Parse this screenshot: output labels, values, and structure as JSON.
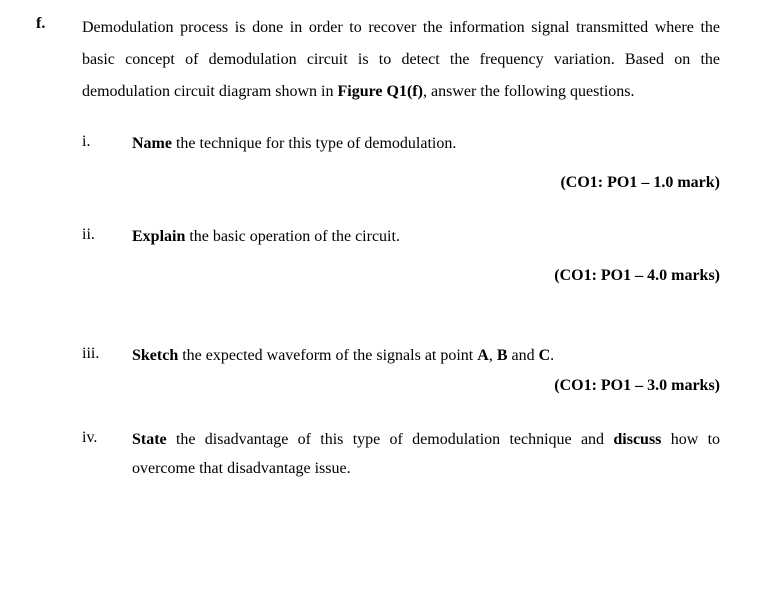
{
  "question": {
    "label": "f.",
    "intro_part1": "Demodulation process is done in order to recover the information signal transmitted where the basic concept of demodulation circuit is to detect the frequency variation. Based on the demodulation circuit diagram shown in ",
    "intro_bold": "Figure Q1(f)",
    "intro_part2": ", answer the following questions."
  },
  "subs": [
    {
      "label": "i.",
      "verb": "Name",
      "text": " the technique for this type of demodulation.",
      "marks": "(CO1: PO1 – 1.0 mark)",
      "marks_class": "marks"
    },
    {
      "label": "ii.",
      "verb": "Explain",
      "text": " the basic operation of the circuit.",
      "marks": "(CO1: PO1 – 4.0 marks)",
      "marks_class": "marks",
      "extra_gap": true
    },
    {
      "label": "iii.",
      "verb": "Sketch",
      "text_before": " the expected waveform of the signals at point ",
      "bold_mid1": "A",
      "mid1": ", ",
      "bold_mid2": "B",
      "mid2": " and ",
      "bold_mid3": "C",
      "text_after": ".",
      "marks": "(CO1: PO1 – 3.0 marks)",
      "marks_class": "marks-tight"
    },
    {
      "label": "iv.",
      "verb": "State",
      "text_before": " the disadvantage of this type of demodulation technique and ",
      "bold_mid1": "discuss",
      "text_after": " how to overcome that disadvantage issue.",
      "marks": "",
      "marks_class": ""
    }
  ]
}
